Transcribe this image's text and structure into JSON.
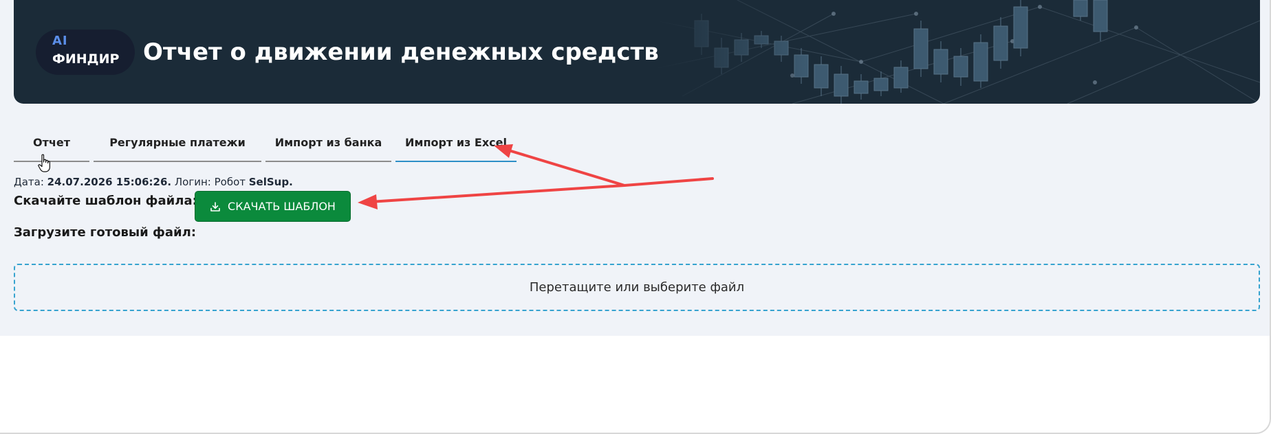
{
  "header": {
    "logo_ai": "AI",
    "logo_name": "ФИНДИР",
    "title": "Отчет о движении денежных средств"
  },
  "tabs": [
    {
      "label": "Отчет",
      "active": false
    },
    {
      "label": "Регулярные платежи",
      "active": false
    },
    {
      "label": "Импорт из банка",
      "active": false
    },
    {
      "label": "Импорт из Excel",
      "active": true
    }
  ],
  "meta": {
    "date_label": "Дата: ",
    "date_value": "24.07.2026 15:06:26.",
    "login_label": " Логин: Робот ",
    "login_value": "SelSup."
  },
  "download": {
    "label": "Скачайте шаблон файла:",
    "button_label": "СКАЧАТЬ ШАБЛОН"
  },
  "upload": {
    "label": "Загрузите готовый файл:",
    "dropzone_text": "Перетащите или выберите файл"
  },
  "colors": {
    "header_bg": "#1b2b38",
    "panel_bg": "#f0f3f8",
    "accent_button": "#0b8a3c",
    "active_tab_underline": "#2d8fc7",
    "dropzone_border": "#36a3cf",
    "annotation_arrow": "#ef4444"
  },
  "icons": {
    "download": "download-icon",
    "cursor": "hand-pointer-icon",
    "annotation": "red-arrow-icon"
  }
}
